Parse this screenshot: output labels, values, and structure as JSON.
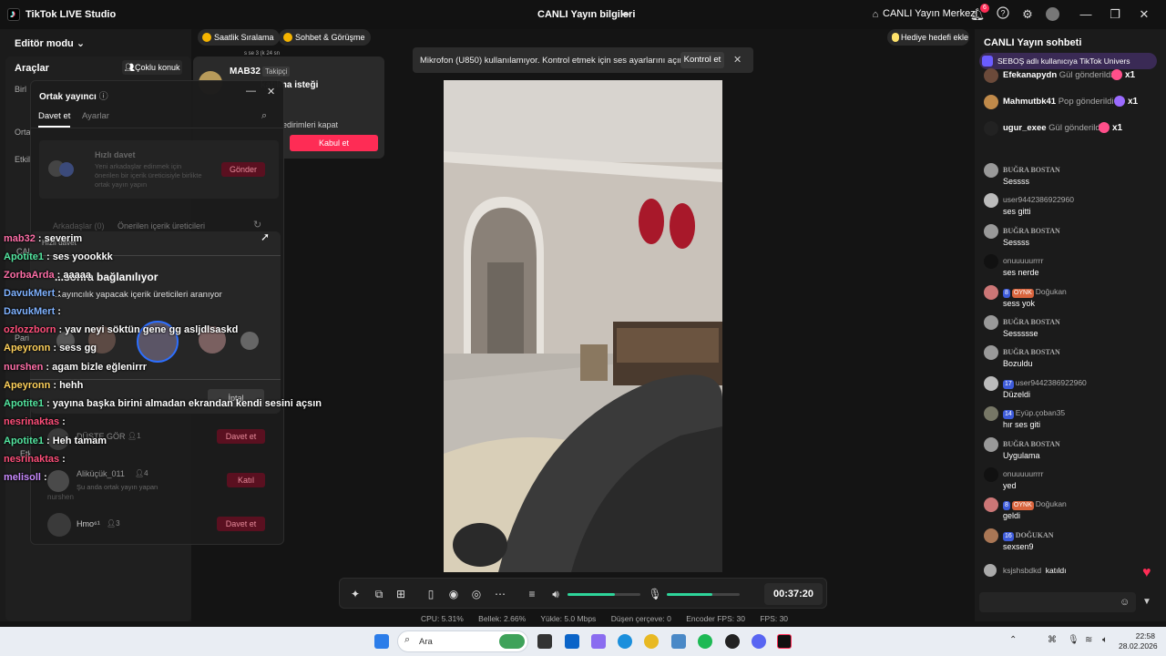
{
  "titlebar": {
    "app_title": "TikTok LIVE Studio",
    "center_title": "CANLI Yayın bilgileri",
    "live_center": "CANLI Yayın Merkezi",
    "notification_count": "6",
    "icons": [
      "bell-icon",
      "help-icon",
      "gear-icon",
      "avatar",
      "minimize-icon",
      "maximize-icon",
      "close-icon"
    ]
  },
  "left_panel": {
    "editor_mode": "Editör modu",
    "tools_label": "Araçlar",
    "multi_guest_button": "Çoklu konuk",
    "frag_1": "Birl",
    "frag_2": "Orta",
    "frag_3": "Etkil",
    "frag_4": "CAL",
    "frag_5": "Pari",
    "frag_6": "Etk"
  },
  "chips": {
    "hourly_ranking": "Saatlik Sıralama",
    "chat_meeting": "Sohbet & Görüşme",
    "gift_goal": "Hediye hedefi ekle"
  },
  "mic_banner": {
    "text": "Mikrofon (U850) kullanılamıyor. Kontrol etmek için ses ayarlarını açın.",
    "button": "Kontrol et"
  },
  "request_popup": {
    "name": "MAB32",
    "tag": "Takipçi",
    "title": "katılma isteği",
    "subtitle": "edirimleri kapat",
    "accept": "Kabul et",
    "meta": "s se 3 (k 24 sn"
  },
  "guest_panel": {
    "title": "Ortak yayıncı",
    "tab_invite": "Davet et",
    "tab_settings": "Ayarlar",
    "quick_invite_title": "Hızlı davet",
    "quick_invite_desc": "Yeni arkadaşlar edinmek için önerilen bir içerik üreticisiyle birlikte ortak yayın yapın",
    "send_button": "Gönder",
    "suggested_header": "Önerilen içerik üreticileri",
    "friends_header": "Arkadaşlar (0)",
    "quick_invite_2": "Hızlı davet",
    "connecting": "...sonra bağlanılıyor",
    "searching": "...ayıncılık yapacak içerik üreticileri aranıyor",
    "cancel": "İptal",
    "rows": [
      {
        "name": "DÜŞTE GÖR",
        "count": "1",
        "action": "Davet et"
      },
      {
        "name": "Aliküçük_011",
        "count": "4",
        "action": "Katıl",
        "sub": "Şu anda ortak yayın yapan"
      },
      {
        "name": "Hmo⁶¹",
        "count": "3",
        "action": "Davet et"
      }
    ],
    "ghost_name": "nurshen"
  },
  "overlay_chat": [
    {
      "name": "mab32",
      "text": ": severim",
      "color": "#ff6fa8"
    },
    {
      "name": "Apotite1",
      "text": ": ses yoookkk",
      "color": "#54e6a0"
    },
    {
      "name": "ZorbaArda",
      "text": ": aaaaa",
      "color": "#ff6fa8"
    },
    {
      "name": "DavukMert",
      "text": ":",
      "color": "#7fb2ff"
    },
    {
      "name": "DavukMert",
      "text": ":",
      "color": "#7fb2ff"
    },
    {
      "name": "ozlozzborn",
      "text": ": yav neyi söktün gene gg asljdlsaskd",
      "color": "#ff4f7a"
    },
    {
      "name": "Apeyronn",
      "text": ": sess gg",
      "color": "#ffd25c"
    },
    {
      "name": "nurshen",
      "text": ": agam bizle eğlenirrr",
      "color": "#ff6fa8"
    },
    {
      "name": "Apeyronn",
      "text": ": hehh",
      "color": "#ffd25c"
    },
    {
      "name": "Apotite1",
      "text": ": yayına başka birini almadan ekrandan kendi sesini açsın",
      "color": "#54e6a0"
    },
    {
      "name": "nesrinaktas",
      "text": ":",
      "color": "#ff4f7a"
    },
    {
      "name": "Apotite1",
      "text": ": Heh tamam",
      "color": "#54e6a0"
    },
    {
      "name": "nesrinaktas",
      "text": ":",
      "color": "#ff4f7a"
    },
    {
      "name": "melisoll",
      "text": ":",
      "color": "#c98bff"
    }
  ],
  "toolbar": {
    "timer": "00:37:20",
    "volume_level": 0.65,
    "mic_level": 0.62
  },
  "stats": {
    "cpu": "CPU: 5.31%",
    "memory": "Bellek: 2.66%",
    "upload": "Yükle: 5.0 Mbps",
    "dropped": "Düşen çerçeve: 0",
    "encoder_fps": "Encoder FPS: 30",
    "fps": "FPS: 30"
  },
  "chat": {
    "title": "CANLI Yayın sohbeti",
    "banner": "SEBOŞ adlı kullanıcıya TikTok Univers",
    "gifts": [
      {
        "name": "Efekanapydn",
        "action": "Gül gönderildi",
        "count": "x1"
      },
      {
        "name": "Mahmutbk41",
        "action": "Pop gönderildi",
        "count": "x1"
      },
      {
        "name": "ugur_exee",
        "action": "Gül gönderildi",
        "count": "x1"
      }
    ],
    "messages": [
      {
        "user": "BUĞRA BOSTAN",
        "text": "Sessss",
        "badges": []
      },
      {
        "user": "user9442386922960",
        "text": "ses gitti",
        "badges": []
      },
      {
        "user": "BUĞRA BOSTAN",
        "text": "Sessss",
        "badges": []
      },
      {
        "user": "onuuuuurrrr",
        "text": "ses nerde",
        "badges": []
      },
      {
        "user": "Doğukan",
        "text": "sess yok",
        "badges": [
          "8",
          "OYNK"
        ]
      },
      {
        "user": "BUĞRA BOSTAN",
        "text": "Sessssse",
        "badges": []
      },
      {
        "user": "BUĞRA BOSTAN",
        "text": "Bozuldu",
        "badges": []
      },
      {
        "user": "user9442386922960",
        "text": "Düzeldi",
        "badges": [
          "17"
        ]
      },
      {
        "user": "Eyüp.çoban35",
        "text": "hır ses giti",
        "badges": [
          "14"
        ]
      },
      {
        "user": "BUĞRA BOSTAN",
        "text": "Uygulama",
        "badges": []
      },
      {
        "user": "onuuuuurrrr",
        "text": "yed",
        "badges": []
      },
      {
        "user": "Doğukan",
        "text": "geldi",
        "badges": [
          "8",
          "OYNK"
        ]
      },
      {
        "user": "DOĞUKAN",
        "text": "sexsen9",
        "badges": [
          "16"
        ]
      }
    ],
    "join_user": "ksjshsbdkd",
    "join_text": "katıldı"
  },
  "taskbar": {
    "search": "Ara",
    "time": "22:58",
    "date": "28.02.2026"
  }
}
